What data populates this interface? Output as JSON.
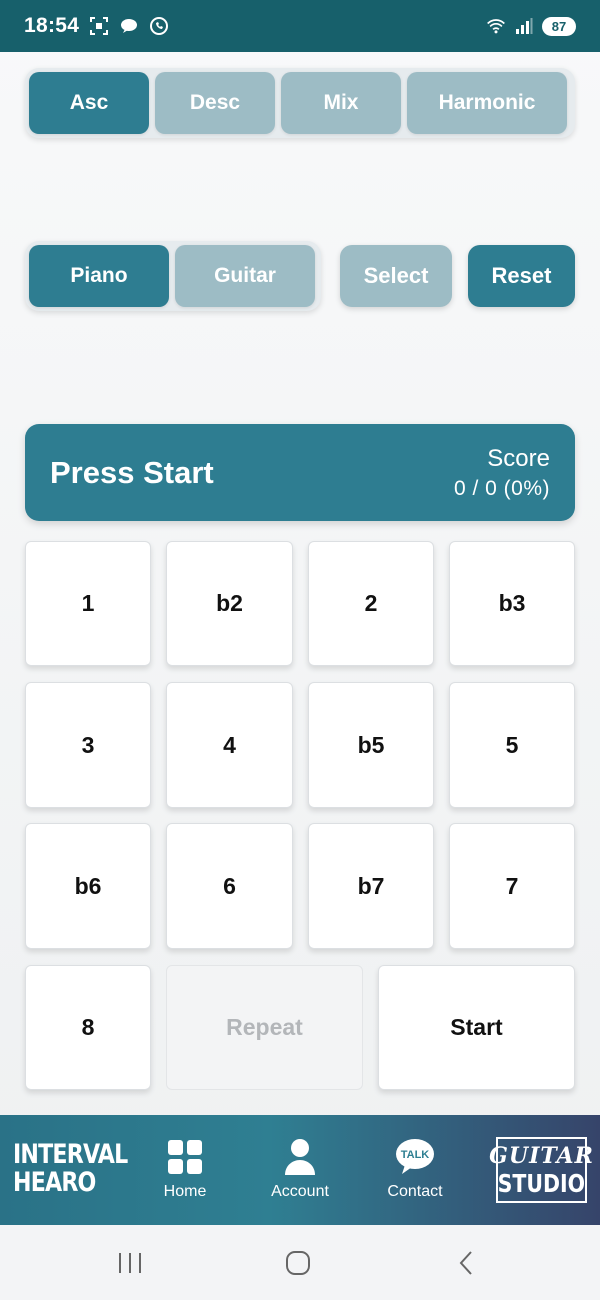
{
  "status_bar": {
    "time": "18:54",
    "battery": "87",
    "icons": [
      "screenshot-icon",
      "chat-bubble-icon",
      "whatsapp-icon",
      "wifi-icon",
      "signal-icon",
      "battery-icon"
    ]
  },
  "direction_tabs": [
    {
      "label": "Asc",
      "active": true
    },
    {
      "label": "Desc",
      "active": false
    },
    {
      "label": "Mix",
      "active": false
    },
    {
      "label": "Harmonic",
      "active": false
    }
  ],
  "instrument_tabs": [
    {
      "label": "Piano",
      "active": true
    },
    {
      "label": "Guitar",
      "active": false
    }
  ],
  "actions": {
    "select_label": "Select",
    "reset_label": "Reset"
  },
  "score_panel": {
    "prompt": "Press Start",
    "score_label": "Score",
    "score_value": "0 / 0 (0%)"
  },
  "interval_keys": [
    "1",
    "b2",
    "2",
    "b3",
    "3",
    "4",
    "b5",
    "5",
    "b6",
    "6",
    "b7",
    "7",
    "8"
  ],
  "controls": {
    "repeat_label": "Repeat",
    "start_label": "Start"
  },
  "bottom_nav": {
    "brand_left_line1": "INTERVAL",
    "brand_left_line2": "HEARO",
    "items": [
      {
        "label": "Home",
        "icon": "grid-icon"
      },
      {
        "label": "Account",
        "icon": "person-icon"
      },
      {
        "label": "Contact",
        "icon": "talk-bubble-icon",
        "icon_text": "TALK"
      }
    ],
    "brand_right_line1": "GUITAR",
    "brand_right_line2": "STUDIO"
  },
  "colors": {
    "primary": "#2e7d91",
    "inactive": "#9dbcc5",
    "status_bar": "#17606b",
    "nav_end": "#36446a"
  }
}
